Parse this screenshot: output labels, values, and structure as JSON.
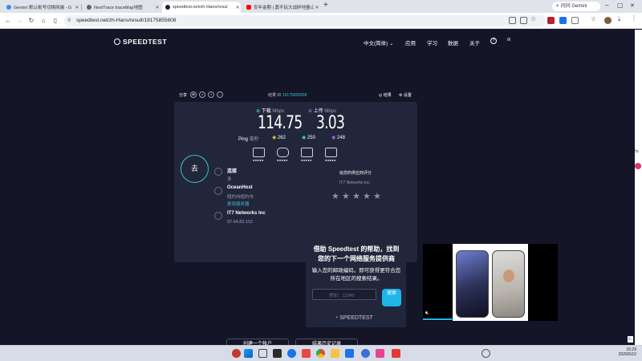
{
  "tabs": [
    {
      "title": "Gemini 默认帐号切换网端 - G",
      "color": "#4285f4"
    },
    {
      "title": "NextTrace traceMap地图",
      "color": "#5f6368"
    },
    {
      "title": "speedtest.net/zh-Hans/resul",
      "color": "#202124"
    },
    {
      "title": "安年金期 | 奠不玩大战碎地量山",
      "color": "#ff0000"
    }
  ],
  "new_tab": "+",
  "window": {
    "gemini": "问问 Gemini",
    "min": "–",
    "max": "▢",
    "close": "✕"
  },
  "omnibar": {
    "url": "speedtest.net/zh-Hans/result/19175855608"
  },
  "site": {
    "logo": "SPEEDTEST",
    "nav": [
      "中文(简体)",
      "应用",
      "学习",
      "数据",
      "关于"
    ],
    "share_label": "分享",
    "result_label": "结果 ID",
    "result_id": "19175855608",
    "results_btn": "结果",
    "settings_btn": "设置",
    "download_label": "下载",
    "upload_label": "上传",
    "unit": "Mbps",
    "download": "114.75",
    "upload": "3.03",
    "ping_label": "Ping",
    "ping_unit": "毫秒",
    "ping_idle": "262",
    "ping_down": "250",
    "ping_up": "248",
    "go_button": "去",
    "connections_label": "连接",
    "connections_value": "多",
    "server_name": "OceanHost",
    "server_location": "纽约州纽约市",
    "change_server": "更改服务器",
    "isp_name": "IT7 Networks Inc",
    "isp_ip": "97.64.82.152",
    "rate_title": "给您的供应商评分",
    "rate_isp": "IT7 Networks Inc",
    "star_glyph": "★",
    "promo_title": "借助 Speedtest 的帮助，找到您的下一个网络服务提供商",
    "promo_body": "输入您的邮政编码，即可获得更符合您所在地区的搜索结果。",
    "promo_placeholder": "例如：12345",
    "promo_btn": "搜索",
    "promo_logo": "SPEEDTEST",
    "bottom_btn1": "创建一个帐户",
    "bottom_btn2": "结果历史记录",
    "ad_flag": "i▷"
  },
  "clock": {
    "time": "15:29",
    "date": "2026/5/10"
  }
}
